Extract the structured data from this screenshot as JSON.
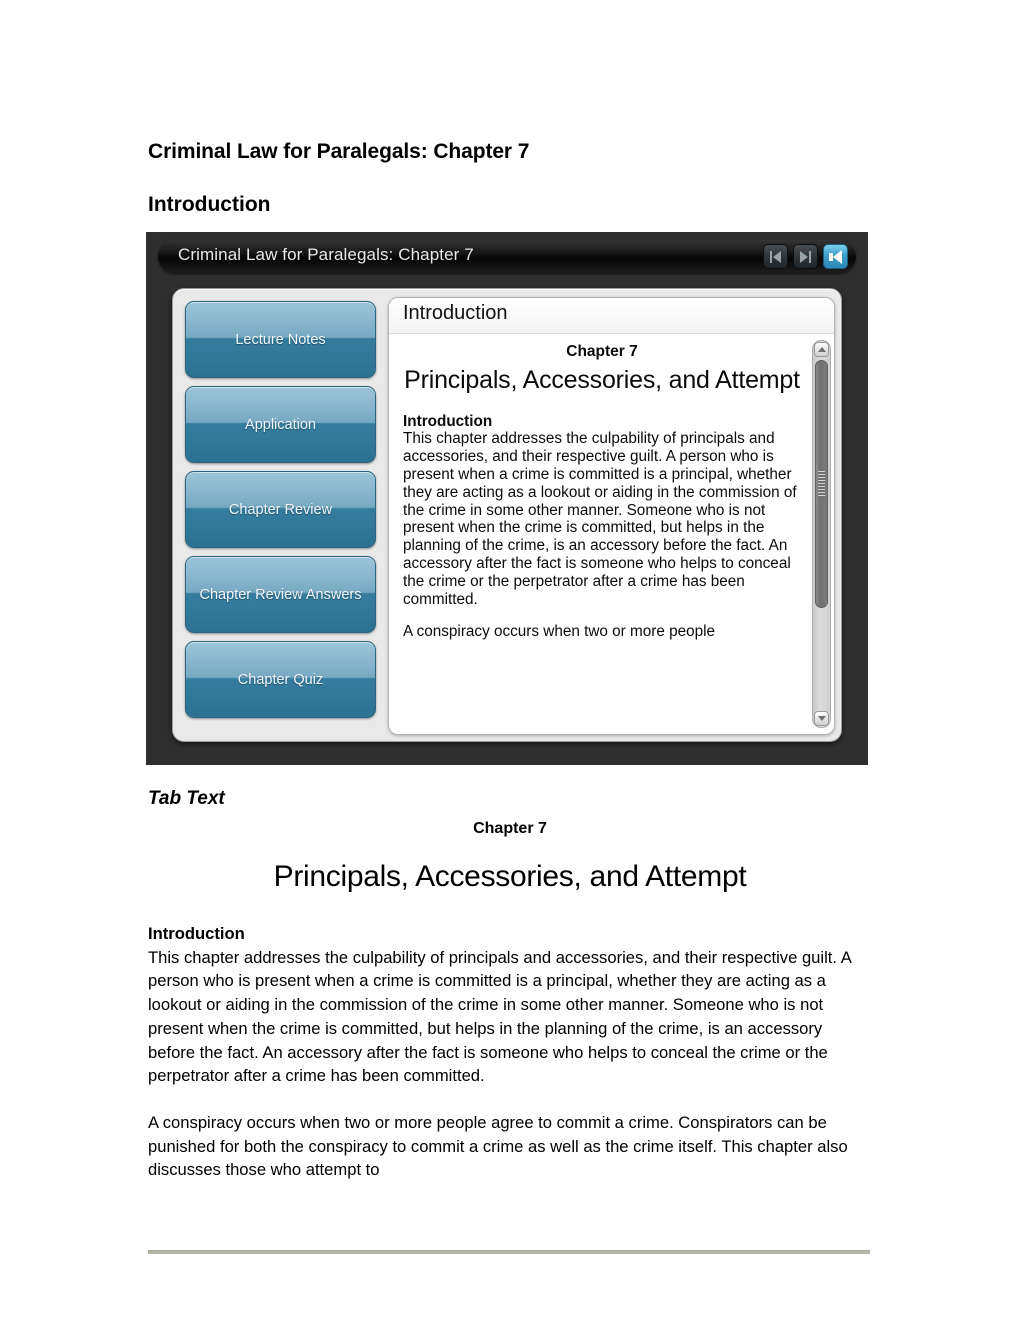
{
  "document": {
    "title": "Criminal Law for Paralegals: Chapter 7",
    "section_heading": "Introduction",
    "tab_text_label": "Tab Text",
    "chapter_label": "Chapter 7",
    "chapter_title": "Principals, Accessories, and Attempt",
    "intro_heading": "Introduction",
    "paragraph_1": "This chapter addresses the culpability of principals and accessories, and their respective guilt.  A person who is present when a crime is committed is a principal, whether they are acting as a lookout or aiding in the commission of the crime in some other manner.  Someone who is not present when the crime is committed, but helps in the planning of the crime, is an accessory before the fact.  An accessory after the fact is someone who helps to conceal the crime or the perpetrator after a crime has been committed.",
    "paragraph_2": "A conspiracy occurs when two or more people agree to commit a crime. Conspirators can be punished for both the conspiracy to commit a crime as well as the crime itself.  This chapter also discusses those who attempt to"
  },
  "player": {
    "titlebar_title": "Criminal Law for Paralegals: Chapter 7",
    "nav": {
      "previous_label": "Previous",
      "next_label": "Next",
      "audio_label": "Audio"
    },
    "menu_items": [
      {
        "label": "Lecture Notes"
      },
      {
        "label": "Application"
      },
      {
        "label": "Chapter Review"
      },
      {
        "label": "Chapter Review Answers"
      },
      {
        "label": "Chapter Quiz"
      }
    ],
    "content": {
      "header": "Introduction",
      "chapter_label": "Chapter 7",
      "chapter_title": "Principals, Accessories, and Attempt",
      "intro_heading": "Introduction",
      "paragraph_1": "This chapter addresses the culpability of principals and accessories, and their respective guilt.  A person who is present when a crime is committed is a principal, whether they are acting as a lookout or aiding in the commission of the crime in some other manner.  Someone who is not present when the crime is committed, but helps in the planning of the crime, is an accessory before the fact.  An accessory after the fact is someone who helps to conceal the crime or the perpetrator after a crime has been committed.",
      "paragraph_2": "A conspiracy occurs when two or more people"
    }
  },
  "colors": {
    "player_background": "#2e2e2e",
    "titlebar": "#0a0a0a",
    "menu_button_top": "#9cc3d6",
    "menu_button_bottom": "#2d7192",
    "accent_button": "#3c9fc9",
    "rule": "#b5b5a8"
  }
}
